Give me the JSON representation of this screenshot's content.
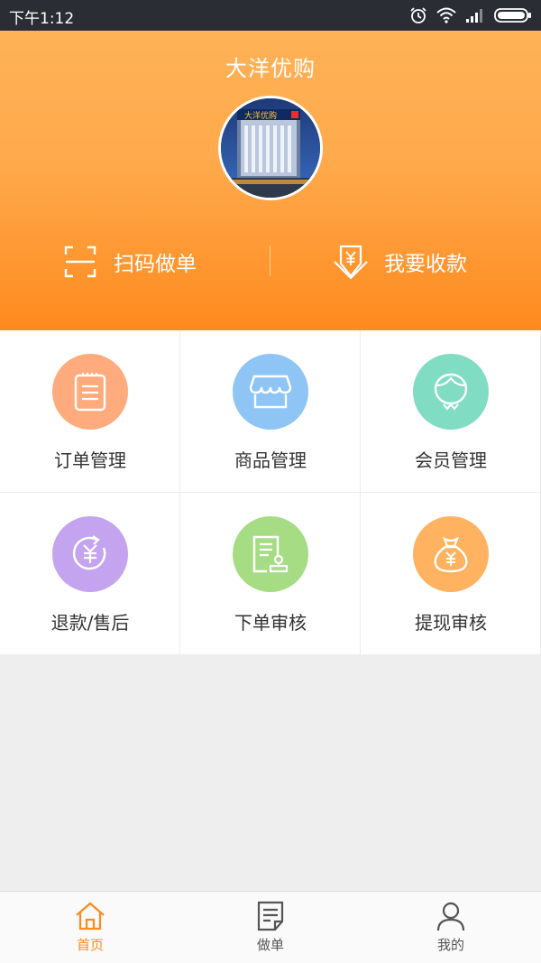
{
  "status_bar": {
    "time": "下午1:12"
  },
  "header": {
    "title": "大洋优购",
    "avatar_sign_text": "大洋优购",
    "scan_label": "扫码做单",
    "collect_label": "我要收款"
  },
  "grid": {
    "items": [
      {
        "label": "订单管理",
        "icon": "order-list-icon",
        "color": "#ffab7d"
      },
      {
        "label": "商品管理",
        "icon": "store-icon",
        "color": "#8ec5f5"
      },
      {
        "label": "会员管理",
        "icon": "member-icon",
        "color": "#80dcc3"
      },
      {
        "label": "退款/售后",
        "icon": "refund-icon",
        "color": "#c4a4ee"
      },
      {
        "label": "下单审核",
        "icon": "order-review-icon",
        "color": "#a6dc84"
      },
      {
        "label": "提现审核",
        "icon": "money-bag-icon",
        "color": "#ffb260"
      }
    ]
  },
  "bottom_nav": {
    "items": [
      {
        "label": "首页",
        "icon": "home-icon",
        "active": true
      },
      {
        "label": "做单",
        "icon": "document-icon",
        "active": false
      },
      {
        "label": "我的",
        "icon": "person-icon",
        "active": false
      }
    ]
  },
  "colors": {
    "accent": "#ff8a1e",
    "header_top": "#ffb257",
    "statusbar": "#2a2e34"
  }
}
